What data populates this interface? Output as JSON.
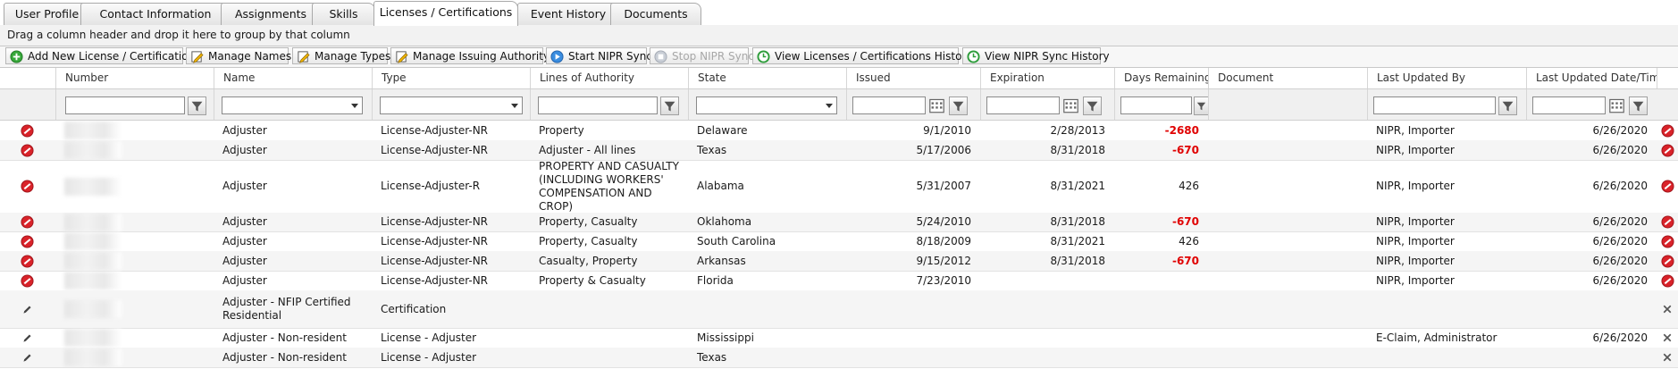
{
  "tabs": [
    {
      "label": "User Profile"
    },
    {
      "label": "Contact Information"
    },
    {
      "label": "Assignments"
    },
    {
      "label": "Skills"
    },
    {
      "label": "Licenses / Certifications",
      "active": true
    },
    {
      "label": "Event History"
    },
    {
      "label": "Documents"
    }
  ],
  "group_hint": "Drag a column header and drop it here to group by that column",
  "toolbar": {
    "add": "Add New License / Certification",
    "names": "Manage Names",
    "types": "Manage Types",
    "authority": "Manage Issuing Authority",
    "start_sync": "Start NIPR Sync",
    "stop_sync": "Stop NIPR Sync",
    "view_history": "View Licenses / Certifications History",
    "view_sync": "View NIPR Sync History"
  },
  "columns": {
    "number": "Number",
    "name": "Name",
    "type": "Type",
    "loa": "Lines of Authority",
    "state": "State",
    "issued": "Issued",
    "expiration": "Expiration",
    "days": "Days Remaining",
    "document": "Document",
    "updated_by": "Last Updated By",
    "updated_at": "Last Updated Date/Time"
  },
  "rows": [
    {
      "name": "Adjuster",
      "type": "License-Adjuster-NR",
      "loa": "Property",
      "state": "Delaware",
      "issued": "9/1/2010",
      "expiration": "2/28/2013",
      "days": "-2680",
      "updated_by": "NIPR, Importer",
      "updated_at": "6/26/2020"
    },
    {
      "name": "Adjuster",
      "type": "License-Adjuster-NR",
      "loa": "Adjuster - All lines",
      "state": "Texas",
      "issued": "5/17/2006",
      "expiration": "8/31/2018",
      "days": "-670",
      "updated_by": "NIPR, Importer",
      "updated_at": "6/26/2020"
    },
    {
      "name": "Adjuster",
      "type": "License-Adjuster-R",
      "loa": "PROPERTY AND CASUALTY (INCLUDING WORKERS' COMPENSATION AND CROP)",
      "state": "Alabama",
      "issued": "5/31/2007",
      "expiration": "8/31/2021",
      "days": "426",
      "updated_by": "NIPR, Importer",
      "updated_at": "6/26/2020"
    },
    {
      "name": "Adjuster",
      "type": "License-Adjuster-NR",
      "loa": "Property, Casualty",
      "state": "Oklahoma",
      "issued": "5/24/2010",
      "expiration": "8/31/2018",
      "days": "-670",
      "updated_by": "NIPR, Importer",
      "updated_at": "6/26/2020"
    },
    {
      "name": "Adjuster",
      "type": "License-Adjuster-NR",
      "loa": "Property, Casualty",
      "state": "South Carolina",
      "issued": "8/18/2009",
      "expiration": "8/31/2021",
      "days": "426",
      "updated_by": "NIPR, Importer",
      "updated_at": "6/26/2020"
    },
    {
      "name": "Adjuster",
      "type": "License-Adjuster-NR",
      "loa": "Casualty, Property",
      "state": "Arkansas",
      "issued": "9/15/2012",
      "expiration": "8/31/2018",
      "days": "-670",
      "updated_by": "NIPR, Importer",
      "updated_at": "6/26/2020"
    },
    {
      "name": "Adjuster",
      "type": "License-Adjuster-NR",
      "loa": "Property & Casualty",
      "state": "Florida",
      "issued": "7/23/2010",
      "expiration": "",
      "days": "",
      "updated_by": "NIPR, Importer",
      "updated_at": "6/26/2020"
    },
    {
      "name": "Adjuster - NFIP Certified Residential",
      "type": "Certification",
      "loa": "",
      "state": "",
      "issued": "",
      "expiration": "",
      "days": "",
      "updated_by": "",
      "updated_at": ""
    },
    {
      "name": "Adjuster - Non-resident",
      "type": "License - Adjuster",
      "loa": "",
      "state": "Mississippi",
      "issued": "",
      "expiration": "",
      "days": "",
      "updated_by": "E-Claim, Administrator",
      "updated_at": "6/26/2020"
    },
    {
      "name": "Adjuster - Non-resident",
      "type": "License - Adjuster",
      "loa": "",
      "state": "Texas",
      "issued": "",
      "expiration": "",
      "days": "",
      "updated_by": "",
      "updated_at": ""
    }
  ],
  "colors": {
    "negative": "#e00000",
    "delete_icon": "#d9232a"
  }
}
